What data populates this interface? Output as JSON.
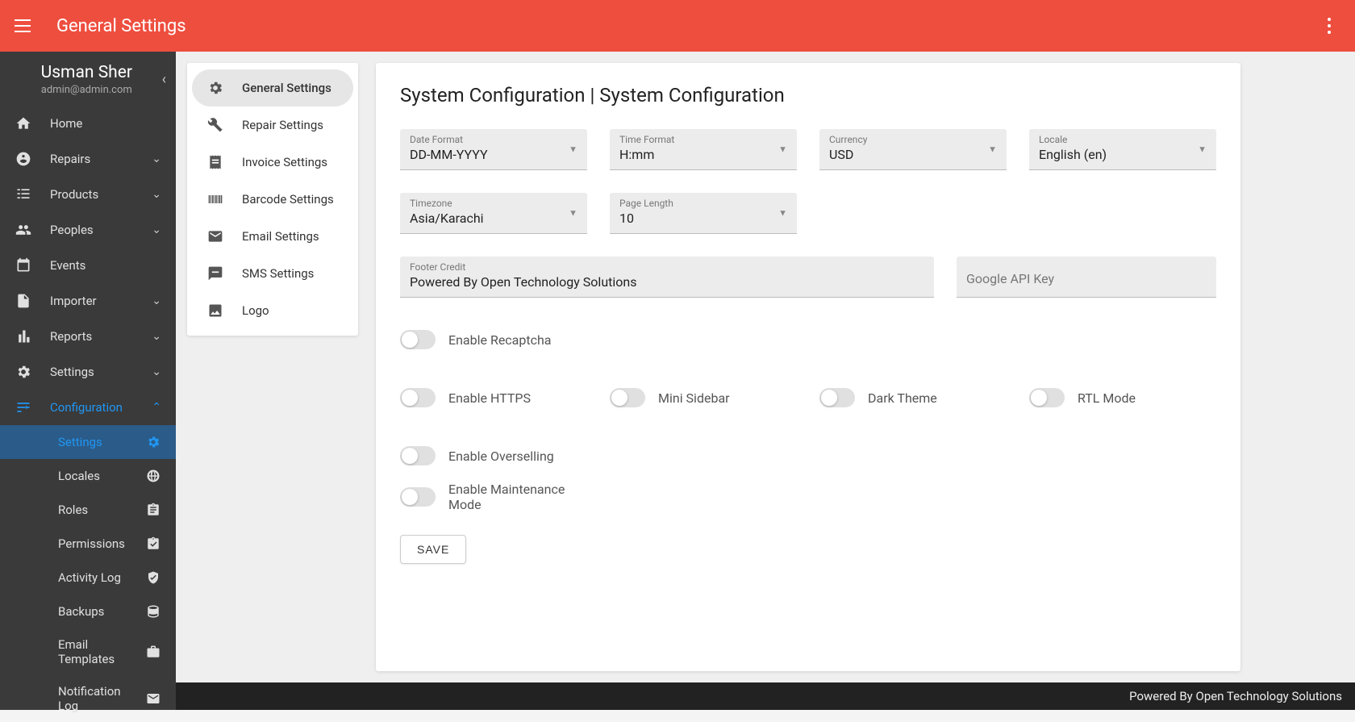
{
  "topbar": {
    "title": "General Settings"
  },
  "user": {
    "name": "Usman Sher",
    "email": "admin@admin.com"
  },
  "sidebar": {
    "home": "Home",
    "repairs": "Repairs",
    "products": "Products",
    "peoples": "Peoples",
    "events": "Events",
    "importer": "Importer",
    "reports": "Reports",
    "settings": "Settings",
    "configuration": "Configuration",
    "sub": {
      "settings": "Settings",
      "locales": "Locales",
      "roles": "Roles",
      "permissions": "Permissions",
      "activity_log": "Activity Log",
      "backups": "Backups",
      "email_templates": "Email Templates",
      "notification_log": "Notification Log"
    }
  },
  "settings_nav": {
    "general": "General Settings",
    "repair": "Repair Settings",
    "invoice": "Invoice Settings",
    "barcode": "Barcode Settings",
    "email": "Email Settings",
    "sms": "SMS Settings",
    "logo": "Logo"
  },
  "card": {
    "title": "System Configuration | System Configuration",
    "fields": {
      "date_format": {
        "label": "Date Format",
        "value": "DD-MM-YYYY"
      },
      "time_format": {
        "label": "Time Format",
        "value": "H:mm"
      },
      "currency": {
        "label": "Currency",
        "value": "USD"
      },
      "locale": {
        "label": "Locale",
        "value": "English (en)"
      },
      "timezone": {
        "label": "Timezone",
        "value": "Asia/Karachi"
      },
      "page_length": {
        "label": "Page Length",
        "value": "10"
      },
      "footer_credit": {
        "label": "Footer Credit",
        "value": "Powered By Open Technology Solutions"
      },
      "google_api": {
        "label": "Google API Key",
        "value": ""
      }
    },
    "toggles": {
      "recaptcha": "Enable Recaptcha",
      "https": "Enable HTTPS",
      "mini_sidebar": "Mini Sidebar",
      "dark_theme": "Dark Theme",
      "rtl": "RTL Mode",
      "overselling": "Enable Overselling",
      "maintenance": "Enable Maintenance Mode"
    },
    "save": "SAVE"
  },
  "footer": {
    "credit": "Powered By Open Technology Solutions"
  }
}
